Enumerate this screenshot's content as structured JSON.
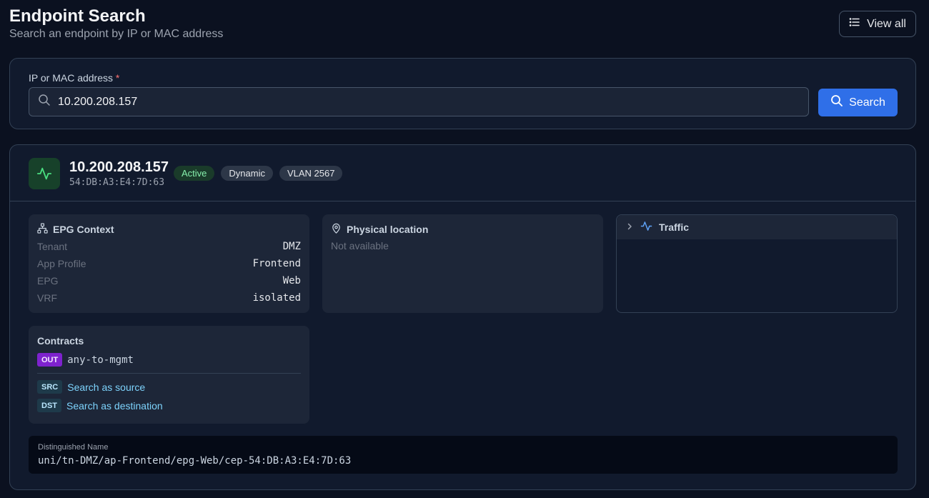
{
  "header": {
    "title": "Endpoint Search",
    "subtitle": "Search an endpoint by IP or MAC address",
    "view_all_label": "View all"
  },
  "search": {
    "label": "IP or MAC address",
    "required_mark": "*",
    "value": "10.200.208.157",
    "button_label": "Search"
  },
  "endpoint": {
    "ip": "10.200.208.157",
    "mac": "54:DB:A3:E4:7D:63",
    "badges": {
      "status": "Active",
      "type": "Dynamic",
      "vlan": "VLAN 2567"
    }
  },
  "epg_context": {
    "title": "EPG Context",
    "rows": [
      {
        "key": "Tenant",
        "value": "DMZ"
      },
      {
        "key": "App Profile",
        "value": "Frontend"
      },
      {
        "key": "EPG",
        "value": "Web"
      },
      {
        "key": "VRF",
        "value": "isolated"
      }
    ]
  },
  "physical_location": {
    "title": "Physical location",
    "text": "Not available"
  },
  "traffic": {
    "title": "Traffic"
  },
  "contracts": {
    "title": "Contracts",
    "items": [
      {
        "direction": "OUT",
        "name": "any-to-mgmt"
      }
    ],
    "links": {
      "src_tag": "SRC",
      "src_label": "Search as source",
      "dst_tag": "DST",
      "dst_label": "Search as destination"
    }
  },
  "distinguished_name": {
    "label": "Distinguished Name",
    "value": "uni/tn-DMZ/ap-Frontend/epg-Web/cep-54:DB:A3:E4:7D:63"
  },
  "colors": {
    "background": "#0b1120",
    "card": "#111a2d",
    "accent_blue": "#2f6fe8",
    "active_green": "#86efac",
    "out_purple": "#7e22ce",
    "link_cyan": "#7dd3fc"
  },
  "icons": {
    "view_all": "list-icon",
    "search": "search-icon",
    "endpoint": "activity-icon",
    "epg": "network-icon",
    "location": "map-pin-icon",
    "traffic": "activity-icon",
    "expand": "chevron-right-icon"
  }
}
